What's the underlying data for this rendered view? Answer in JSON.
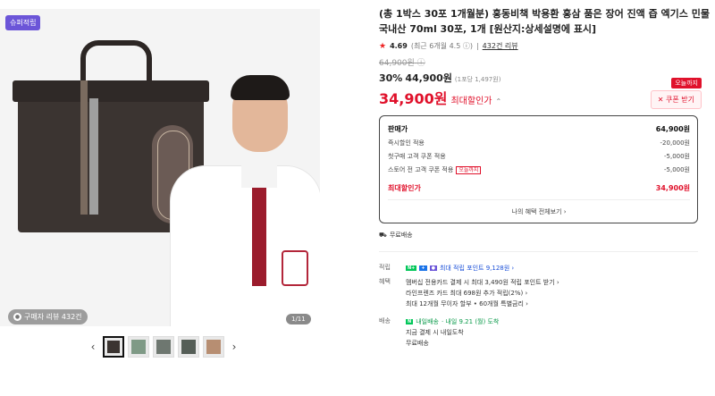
{
  "gallery": {
    "badge": "슈퍼적립",
    "review_chip": "구매자 리뷰 432건",
    "counter": "1/11",
    "prev_arrow": "‹",
    "next_arrow": "›",
    "thumbnail_count": 5
  },
  "product": {
    "title": "(총 1박스 30포 1개월분) 홍동비책 박용환 홍삼 품은 장어 진액 즙 엑기스 민물 국내산 70ml 30포, 1개 [원산지:상세설명에 표시]",
    "rating": "4.69",
    "rating_note": "(최근 6개월 4.5",
    "rating_note_end": ")",
    "review_link": "432건 리뷰",
    "original_price": "64,900원",
    "discount_percent": "30%",
    "discount_price": "44,900원",
    "unit_price_note": "(1포당 1,497원)",
    "max_price": "34,900원",
    "max_label": "최대할인가",
    "coupon_today": "오늘까지",
    "coupon_button": "쿠폰 받기"
  },
  "price_box": {
    "rows": [
      {
        "label": "판매가",
        "value": "64,900원"
      },
      {
        "label": "즉시할인 적용",
        "value": "-20,000원"
      },
      {
        "label": "첫구매 고객 쿠폰 적용",
        "value": "-5,000원"
      },
      {
        "label": "스토어 전 고객 쿠폰 적용",
        "tag": "오늘까지",
        "value": "-5,000원"
      }
    ],
    "max_label": "최대할인가",
    "max_value": "34,900원",
    "footer_link": "나의 혜택 전체보기 ›"
  },
  "shipping_badge": "무료배송",
  "benefits": {
    "points_label": "적립",
    "points_text": "최대 적립 포인트 9,128원 ›",
    "perks_label": "혜택",
    "perks": [
      "멤버십 전용카드 결제 시 최대 3,490원 적립 포인트 받기 ›",
      "라인프렌즈 카드 최대 698원 추가 적립(2%) ›",
      "최대 12개월 무이자 할부 • 60개월 특별금리 ›"
    ],
    "delivery_label": "배송",
    "delivery_badge": "내일배송",
    "delivery_date": "· 내일 9.21 (월) 도착",
    "delivery_lines": [
      "지금 결제 시 내일도착",
      "무료배송"
    ]
  },
  "colors": {
    "accent_red": "#e0112b",
    "naver_green": "#03c75a",
    "badge_purple": "#6b55d8"
  }
}
